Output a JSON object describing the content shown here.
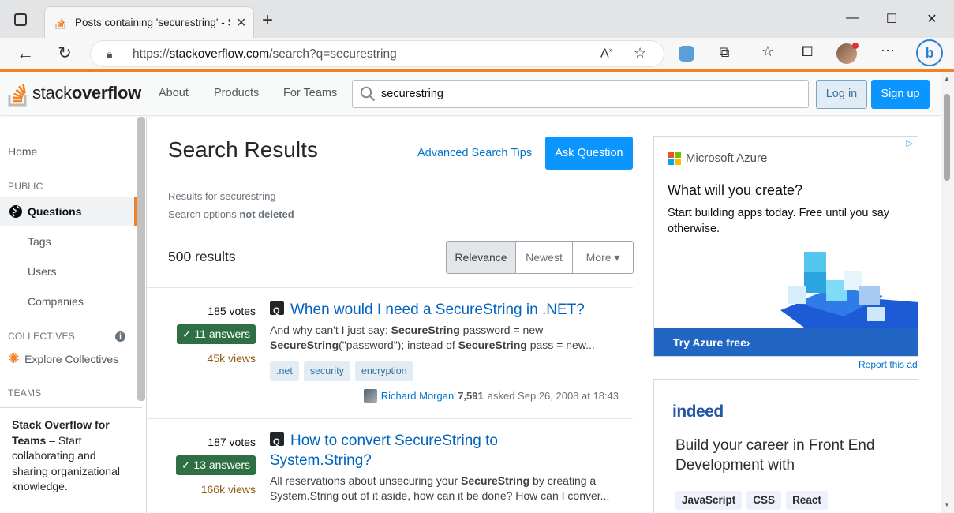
{
  "browser": {
    "tab_title": "Posts containing 'securestring' - S",
    "tab_close": "✕",
    "new_tab": "+",
    "url_prefix": "https://",
    "url_host": "stackoverflow.com",
    "url_path": "/search?q=securestring"
  },
  "so_header": {
    "logo_text_a": "stack",
    "logo_text_b": "overflow",
    "nav": [
      "About",
      "Products",
      "For Teams"
    ],
    "search_value": "securestring",
    "login": "Log in",
    "signup": "Sign up"
  },
  "leftnav": {
    "home": "Home",
    "public": "PUBLIC",
    "questions": "Questions",
    "tags": "Tags",
    "users": "Users",
    "companies": "Companies",
    "collectives": "COLLECTIVES",
    "explore": "Explore Collectives",
    "teams": "TEAMS",
    "teams_title": "Stack Overflow for Teams",
    "teams_text": " – Start collaborating and sharing organizational knowledge."
  },
  "main": {
    "title": "Search Results",
    "adv_tips": "Advanced Search Tips",
    "ask": "Ask Question",
    "results_for_label": "Results for ",
    "results_for_value": "securestring",
    "options_label": "Search options ",
    "options_value": "not deleted",
    "count": "500 results",
    "filters": [
      "Relevance",
      "Newest",
      "More ▾"
    ]
  },
  "results": [
    {
      "votes": "185 votes",
      "answers": "✓ 11 answers",
      "views": "45k views",
      "title": "When would I need a SecureString in .NET?",
      "excerpt_line1": "And why can't I just say: <b>SecureString</b> password = new",
      "excerpt_line2": "<b>SecureString</b>(\"password\"); instead of <b>SecureString</b> pass = new...",
      "tags": [
        ".net",
        "security",
        "encryption"
      ],
      "user": "Richard Morgan",
      "rep": "7,591",
      "asked": "asked Sep 26, 2008 at 18:43"
    },
    {
      "votes": "187 votes",
      "answers": "✓ 13 answers",
      "views": "166k views",
      "title_line1": "How to convert SecureString to",
      "title_line2": "System.String?",
      "excerpt_line1": "All reservations about unsecuring your <b>SecureString</b> by creating a",
      "excerpt_line2": "System.String out of it aside, how can it be done? How can I conver..."
    }
  ],
  "ads": {
    "azure_brand": "Microsoft Azure",
    "azure_head": "What will you create?",
    "azure_text": "Start building apps today. Free until you say otherwise.",
    "azure_cta": "Try Azure free›",
    "report": "Report this ad",
    "indeed_logo": "indeed",
    "indeed_head": "Build your career in Front End Development with",
    "indeed_chips": [
      "JavaScript",
      "CSS",
      "React"
    ]
  }
}
